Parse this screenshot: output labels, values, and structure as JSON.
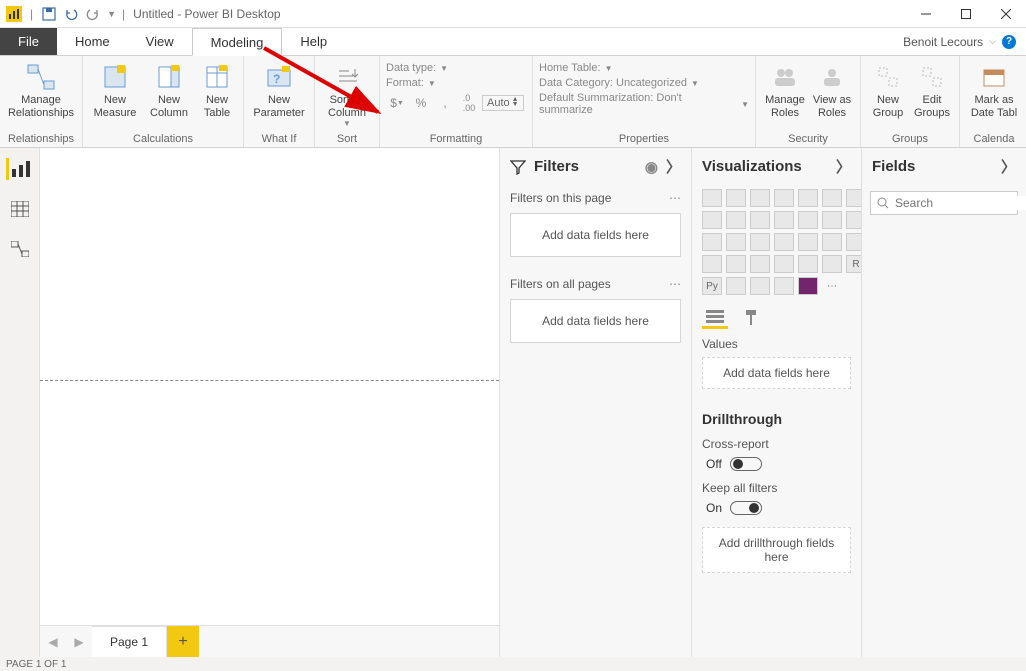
{
  "title": "Untitled - Power BI Desktop",
  "username": "Benoit Lecours",
  "menu": {
    "file": "File",
    "home": "Home",
    "view": "View",
    "modeling": "Modeling",
    "help": "Help"
  },
  "ribbon": {
    "relationships": {
      "manage": "Manage Relationships",
      "group": "Relationships"
    },
    "calculations": {
      "measure": "New Measure",
      "column": "New Column",
      "table": "New Table",
      "group": "Calculations"
    },
    "whatif": {
      "param": "New Parameter",
      "group": "What If"
    },
    "sort": {
      "sortby": "Sort by Column",
      "group": "Sort"
    },
    "formatting": {
      "datatype": "Data type:",
      "format": "Format:",
      "auto": "Auto",
      "group": "Formatting"
    },
    "properties": {
      "hometable": "Home Table:",
      "category": "Data Category: Uncategorized",
      "summ": "Default Summarization: Don't summarize",
      "group": "Properties"
    },
    "security": {
      "manage": "Manage Roles",
      "viewas": "View as Roles",
      "group": "Security"
    },
    "groups": {
      "new": "New Group",
      "edit": "Edit Groups",
      "group": "Groups"
    },
    "calendar": {
      "mark": "Mark as Date Tabl",
      "group": "Calenda"
    }
  },
  "filters": {
    "title": "Filters",
    "onpage": "Filters on this page",
    "allpages": "Filters on all pages",
    "drop": "Add data fields here"
  },
  "viz": {
    "title": "Visualizations",
    "values": "Values",
    "drop": "Add data fields here",
    "drill": "Drillthrough",
    "cross": "Cross-report",
    "off": "Off",
    "keep": "Keep all filters",
    "on": "On",
    "drilldrop": "Add drillthrough fields here"
  },
  "fields": {
    "title": "Fields",
    "search": "Search"
  },
  "pages": {
    "p1": "Page 1"
  },
  "status": "PAGE 1 OF 1"
}
